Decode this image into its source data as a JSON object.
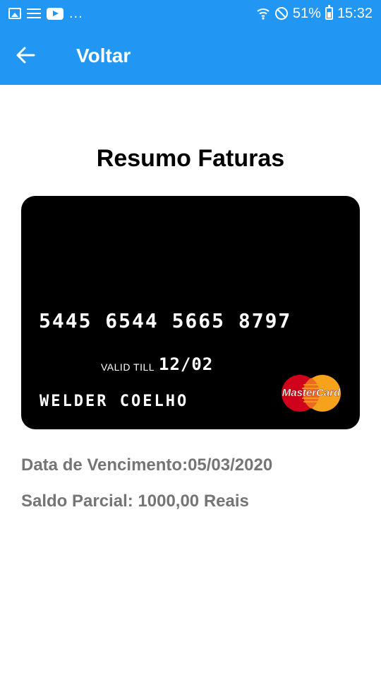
{
  "status_bar": {
    "left_icons": [
      "image-icon",
      "list-icon",
      "youtube-icon"
    ],
    "more": "...",
    "right_icons": [
      "wifi-icon",
      "do-not-disturb-icon",
      "battery-charging-icon"
    ],
    "battery": "51%",
    "time": "15:32"
  },
  "app_bar": {
    "back_icon": "arrow-back-icon",
    "title": "Voltar",
    "color": "#2196f3"
  },
  "page": {
    "title": "Resumo Faturas"
  },
  "card": {
    "number": "5445 6544 5665 8797",
    "valid_till_label": "VALID TILL",
    "valid_till": "12/02",
    "holder": "WELDER COELHO",
    "brand": "MasterCard",
    "background": "#000000"
  },
  "invoice": {
    "due_date_text": "Data de Vencimento:05/03/2020",
    "balance_text": "Saldo Parcial: 1000,00 Reais"
  }
}
